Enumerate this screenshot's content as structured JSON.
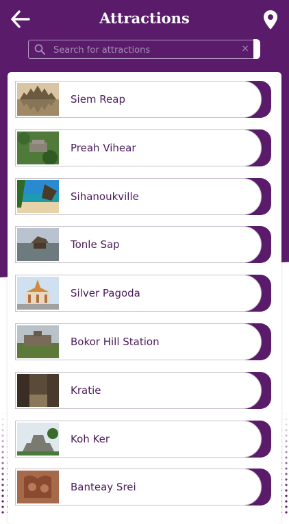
{
  "header": {
    "title": "Attractions",
    "back_icon": "arrow-left-icon",
    "location_icon": "map-pin-icon"
  },
  "search": {
    "placeholder": "Search for attractions",
    "value": "",
    "clear_label": "×"
  },
  "colors": {
    "brand": "#5a1b6b",
    "text": "#4a1a5a",
    "background": "#ffffff"
  },
  "attractions": [
    {
      "name": "Siem Reap",
      "thumb_icon": "temple-reflection-photo"
    },
    {
      "name": "Preah Vihear",
      "thumb_icon": "ruins-forest-photo"
    },
    {
      "name": "Sihanoukville",
      "thumb_icon": "beach-palm-photo"
    },
    {
      "name": "Tonle Sap",
      "thumb_icon": "floating-village-photo"
    },
    {
      "name": "Silver Pagoda",
      "thumb_icon": "pagoda-photo"
    },
    {
      "name": "Bokor Hill Station",
      "thumb_icon": "old-building-photo"
    },
    {
      "name": "Kratie",
      "thumb_icon": "street-photo"
    },
    {
      "name": "Koh Ker",
      "thumb_icon": "pyramid-temple-photo"
    },
    {
      "name": "Banteay Srei",
      "thumb_icon": "carving-photo"
    }
  ]
}
